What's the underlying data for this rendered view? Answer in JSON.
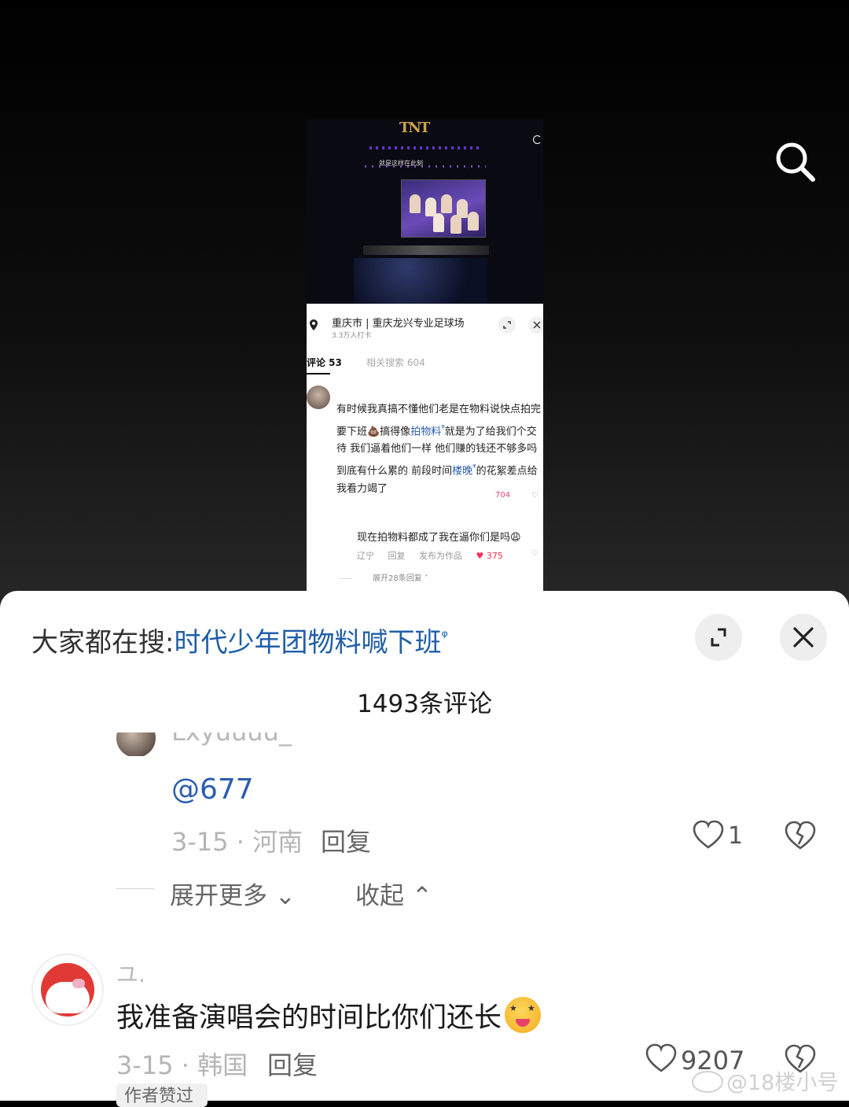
{
  "embedded": {
    "video": {
      "logo_text": "TNT",
      "overlay_text": "就是这样在此刻"
    },
    "location": {
      "title": "重庆市 | 重庆龙兴专业足球场",
      "subtitle": "3.3万人打卡"
    },
    "tabs": {
      "active": "评论 53",
      "other": "相关搜索 604"
    },
    "comment1": {
      "text_before_link1": "有时候我真搞不懂他们老是在物料说快点拍完要下班💩搞得像",
      "link1": "拍物料",
      "text_after_link1": "就是为了给我们个交待 我们逼着他们一样 他们赚的钱还不够多吗 到底有什么累的 前段时间",
      "link2": "楼晚",
      "text_after_link2": "的花絮差点给我看力竭了",
      "likes": "704"
    },
    "comment2": {
      "text": "现在拍物料都成了我在逼你们是吗😩",
      "location": "辽宁",
      "reply": "回复",
      "publish": "发布为作品",
      "likes": "375",
      "expand": "展开28条回复"
    }
  },
  "panel": {
    "hot_search_label": "大家都在搜:",
    "hot_search_query": "时代少年团物料喊下班",
    "comment_count": "1493条评论",
    "reply_comment": {
      "username": "Lxyuuuu_",
      "text": "@677",
      "date_location": "3-15 · 河南",
      "reply_label": "回复",
      "likes": "1"
    },
    "expand_more": "展开更多",
    "collapse": "收起",
    "main_comment": {
      "username": "ユ.",
      "text": "我准备演唱会的时间比你们还长",
      "date_location": "3-15 · 韩国",
      "reply_label": "回复",
      "likes": "9207",
      "author_badge": "作者赞过"
    }
  },
  "watermark": "@18楼小号",
  "icons": {
    "search": "search-icon",
    "expand": "expand-icon",
    "close": "close-icon",
    "like": "heart-icon",
    "dislike": "broken-heart-icon"
  },
  "colors": {
    "link_blue": "#1f5ea8",
    "heart_red": "#ff2d55"
  }
}
